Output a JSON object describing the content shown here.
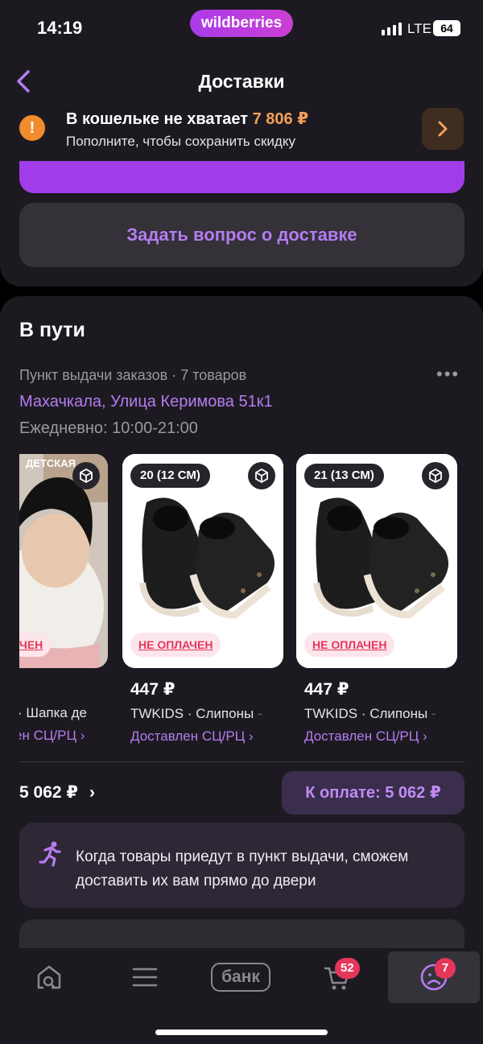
{
  "status_bar": {
    "time": "14:19",
    "brand": "wildberries",
    "network": "LTE",
    "battery": "64"
  },
  "header": {
    "title": "Доставки"
  },
  "wallet_banner": {
    "text": "В кошельке не хватает",
    "amount": "7 806 ₽",
    "subtitle": "Пополните, чтобы сохранить скидку"
  },
  "courier_button": {
    "label": ""
  },
  "ask_button": {
    "label": "Задать вопрос о доставке"
  },
  "delivery": {
    "title": "В пути",
    "pickup_info": "Пункт выдачи заказов · 7 товаров",
    "address": "Махачкала, Улица Керимова 51к1",
    "hours": "Ежедневно: 10:00-21:00",
    "products": [
      {
        "badge_top": "ДЕТСКАЯ",
        "status_badge": "ЧЕН",
        "name": "· Шапка де",
        "state": "ен СЦ/РЦ ›"
      },
      {
        "size": "20 (12 СМ)",
        "status_badge": "НЕ ОПЛАЧЕН",
        "price": "447 ₽",
        "name": "TWKIDS · Слипоны",
        "name_tail": " -",
        "state": "Доставлен СЦ/РЦ ›"
      },
      {
        "size": "21 (13 СМ)",
        "status_badge": "НЕ ОПЛАЧЕН",
        "price": "447 ₽",
        "name": "TWKIDS · Слипоны",
        "name_tail": " -",
        "state": "Доставлен СЦ/РЦ ›"
      }
    ],
    "total": "5 062 ₽",
    "pay_button": "К оплате: 5 062 ₽",
    "courier_info": "Когда товары приедут в пункт выдачи, сможем доставить их вам прямо до двери"
  },
  "tab_bar": {
    "items": [
      {
        "name": "home-search",
        "icon": "home-search-icon"
      },
      {
        "name": "catalog",
        "icon": "menu-icon"
      },
      {
        "name": "bank",
        "label": "банк"
      },
      {
        "name": "cart",
        "icon": "cart-icon",
        "badge": "52"
      },
      {
        "name": "profile",
        "icon": "profile-icon",
        "badge": "7"
      }
    ]
  },
  "colors": {
    "accent": "#b47cf0",
    "warning": "#f08c2e",
    "danger": "#e5375a",
    "background": "#1c1a20"
  }
}
